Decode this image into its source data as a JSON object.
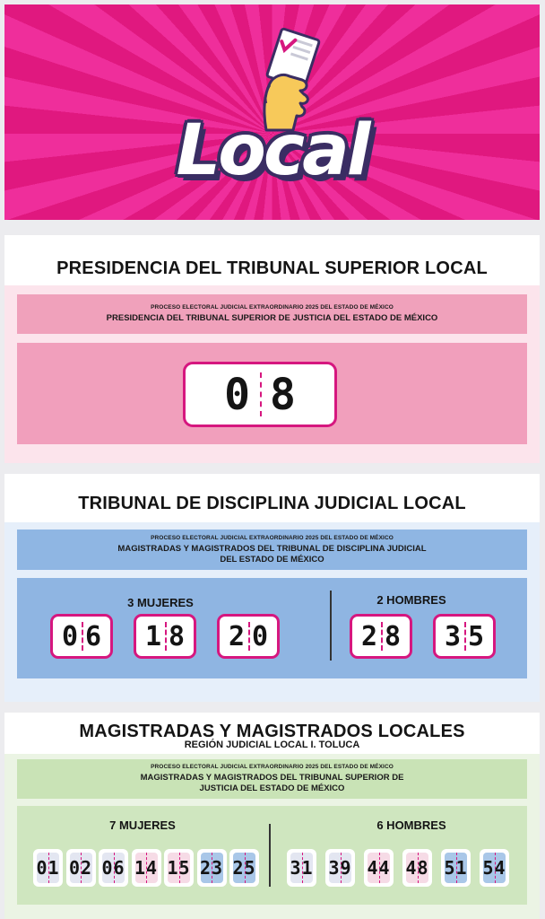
{
  "banner": {
    "logo_text": "Local"
  },
  "sections": [
    {
      "title": "PRESIDENCIA DEL TRIBUNAL SUPERIOR LOCAL",
      "info_small": "PROCESO ELECTORAL JUDICIAL EXTRAORDINARIO 2025 DEL ESTADO DE MÉXICO",
      "info_main": "PRESIDENCIA DEL TRIBUNAL SUPERIOR DE JUSTICIA DEL ESTADO DE MÉXICO",
      "number": "08",
      "colors": {
        "card_bg": "#fce4ec",
        "info_bg": "#f0a1bb",
        "panel_bg": "#f19fbc"
      }
    },
    {
      "title": "TRIBUNAL DE DISCIPLINA JUDICIAL LOCAL",
      "info_small": "PROCESO ELECTORAL JUDICIAL EXTRAORDINARIO 2025 DEL ESTADO DE MÉXICO",
      "info_main": "MAGISTRADAS Y MAGISTRADOS DEL TRIBUNAL DE DISCIPLINA JUDICIAL\nDEL ESTADO DE MÉXICO",
      "women_label": "3 MUJERES",
      "men_label": "2 HOMBRES",
      "women_numbers": [
        "06",
        "18",
        "20"
      ],
      "men_numbers": [
        "28",
        "35"
      ],
      "colors": {
        "card_bg": "#e6effa",
        "info_bg": "#8fb6e3",
        "panel_bg": "#8fb5e2"
      }
    },
    {
      "title": "MAGISTRADAS Y MAGISTRADOS LOCALES",
      "subtitle": "REGIÓN JUDICIAL LOCAL I. TOLUCA",
      "info_small": "PROCESO ELECTORAL JUDICIAL EXTRAORDINARIO 2025 DEL ESTADO DE MÉXICO",
      "info_main": "MAGISTRADAS Y MAGISTRADOS DEL TRIBUNAL SUPERIOR DE\nJUSTICIA DEL ESTADO DE MÉXICO",
      "women_label": "7 MUJERES",
      "men_label": "6 HOMBRES",
      "women_numbers": [
        "01",
        "02",
        "06",
        "14",
        "15",
        "23",
        "25"
      ],
      "men_numbers": [
        "31",
        "39",
        "44",
        "48",
        "51",
        "54"
      ],
      "women_tile_colors": [
        "#e3e6f1",
        "#e3e6f1",
        "#e3e6f1",
        "#f6dbe6",
        "#f6dbe6",
        "#a9c7e8",
        "#a9c7e8"
      ],
      "men_tile_colors": [
        "#e3e6f1",
        "#e3e6f1",
        "#f6dbe6",
        "#f6dbe6",
        "#a9c7e8",
        "#a9c7e8"
      ],
      "colors": {
        "card_bg": "#ebf4e4",
        "info_bg": "#c9e3b6",
        "panel_bg": "#cfe6bf"
      }
    }
  ],
  "colors": {
    "accent": "#d6177f",
    "banner_pink": "#ef2e9b"
  }
}
